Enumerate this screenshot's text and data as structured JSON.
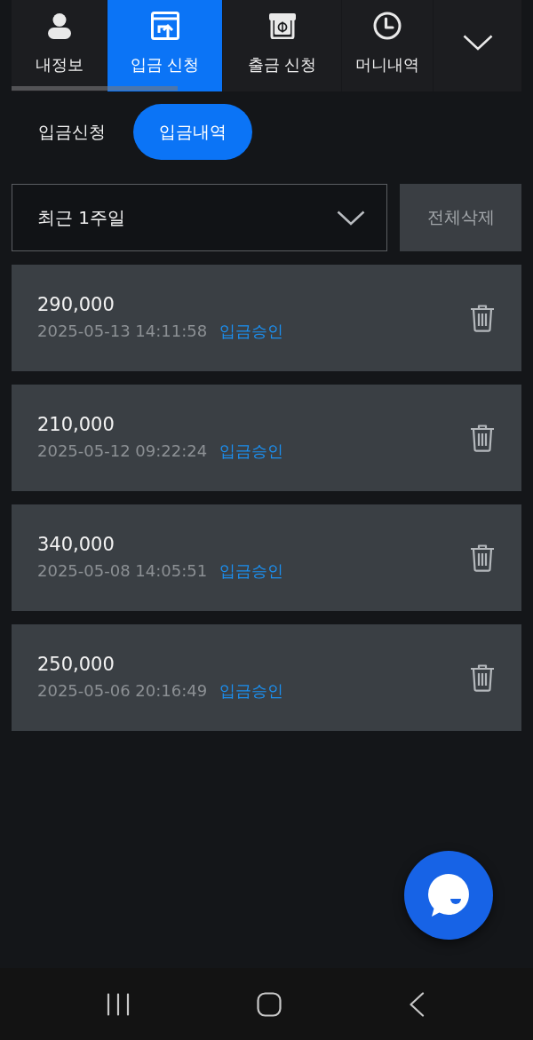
{
  "top_nav": {
    "tabs": [
      {
        "label": "내정보",
        "selected": false
      },
      {
        "label": "입금 신청",
        "selected": true
      },
      {
        "label": "출금 신청",
        "selected": false
      },
      {
        "label": "머니내역",
        "selected": false
      }
    ]
  },
  "sub_tabs": [
    {
      "label": "입금신청",
      "selected": false
    },
    {
      "label": "입금내역",
      "selected": true
    }
  ],
  "filter": {
    "period": "최근 1주일",
    "delete_all_button": "전체삭제"
  },
  "records": [
    {
      "amount": "290,000",
      "datetime": "2025-05-13 14:11:58",
      "status": "입금승인"
    },
    {
      "amount": "210,000",
      "datetime": "2025-05-12 09:22:24",
      "status": "입금승인"
    },
    {
      "amount": "340,000",
      "datetime": "2025-05-08 14:05:51",
      "status": "입금승인"
    },
    {
      "amount": "250,000",
      "datetime": "2025-05-06 20:16:49",
      "status": "입금승인"
    }
  ]
}
